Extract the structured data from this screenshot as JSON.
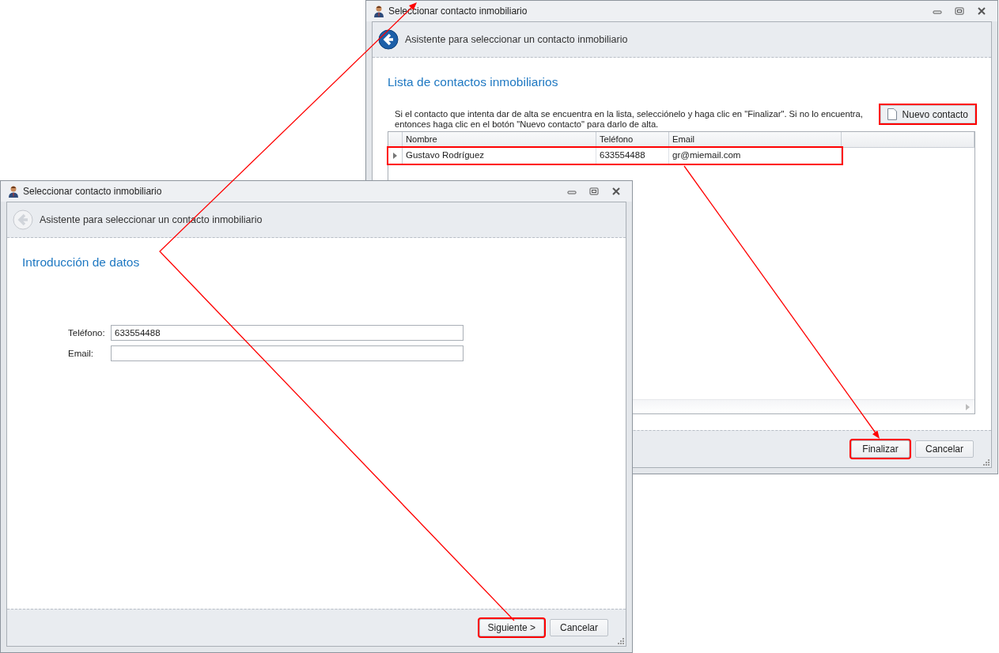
{
  "windows": [
    {
      "kind": "list",
      "title": "Seleccionar contacto inmobiliario",
      "subtitle": "Asistente para seleccionar un contacto inmobiliario",
      "back_enabled": true,
      "page_title": "Lista de contactos inmobiliarios",
      "instructions": "Si el contacto que intenta dar de alta  se encuentra en la lista, selecciónelo y haga clic en \"Finalizar\". Si no lo encuentra, entonces  haga clic en el botón \"Nuevo contacto\" para darlo de alta.",
      "new_button": {
        "label": "Nuevo contacto",
        "highlighted": true
      },
      "table": {
        "columns": [
          "Nombre",
          "Teléfono",
          "Email"
        ],
        "rows": [
          {
            "cells": [
              "Gustavo Rodríguez",
              "633554488",
              "gr@miemail.com"
            ],
            "selected": true,
            "highlighted": true
          }
        ]
      },
      "buttons": [
        {
          "label": "Finalizar",
          "highlighted": true
        },
        {
          "label": "Cancelar",
          "highlighted": false
        }
      ]
    },
    {
      "kind": "form",
      "title": "Seleccionar contacto inmobiliario",
      "subtitle": "Asistente para seleccionar un contacto inmobiliario",
      "back_enabled": false,
      "page_title": "Introducción de datos",
      "fields": [
        {
          "label": "Teléfono:",
          "value": "633554488"
        },
        {
          "label": "Email:"
        }
      ],
      "buttons": [
        {
          "label": "Siguiente >",
          "highlighted": true
        },
        {
          "label": "Cancelar",
          "highlighted": false
        }
      ]
    }
  ]
}
